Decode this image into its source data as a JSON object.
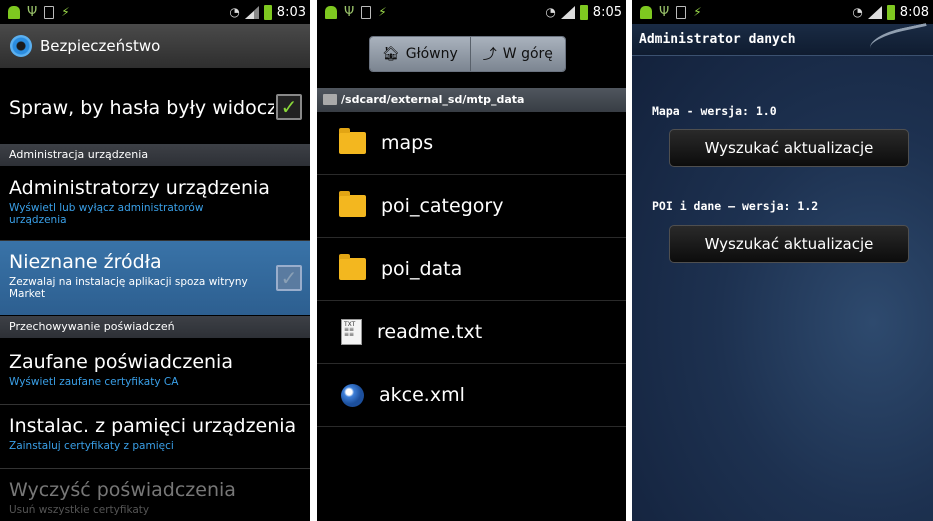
{
  "screens": {
    "security": {
      "time": "8:03",
      "title": "Bezpieczeństwo",
      "show_passwords": "Spraw, by hasła były widoczne",
      "section_admin": "Administracja urządzenia",
      "device_admins": {
        "title": "Administratorzy urządzenia",
        "sub": "Wyświetl lub wyłącz administratorów urządzenia"
      },
      "unknown_sources": {
        "title": "Nieznane źródła",
        "sub": "Zezwalaj na instalację aplikacji spoza witryny Market"
      },
      "section_credentials": "Przechowywanie poświadczeń",
      "trusted": {
        "title": "Zaufane poświadczenia",
        "sub": "Wyświetl zaufane certyfikaty CA"
      },
      "install": {
        "title": "Instalac. z pamięci urządzenia",
        "sub": "Zainstaluj certyfikaty z pamięci"
      },
      "clear": {
        "title": "Wyczyść poświadczenia",
        "sub": "Usuń wszystkie certyfikaty"
      }
    },
    "files": {
      "time": "8:05",
      "home_button": "Główny",
      "up_button": "W górę",
      "path": "/sdcard/external_sd/mtp_data",
      "items": [
        {
          "name": "maps",
          "icon": "folder-icon"
        },
        {
          "name": "poi_category",
          "icon": "folder-icon"
        },
        {
          "name": "poi_data",
          "icon": "folder-icon"
        },
        {
          "name": "readme.txt",
          "icon": "text-file-icon"
        },
        {
          "name": "akce.xml",
          "icon": "globe-icon"
        }
      ]
    },
    "admin": {
      "time": "8:08",
      "header": "Administrator danych",
      "map_version": "Mapa - wersja: 1.0",
      "map_button": "Wyszukać aktualizacje",
      "poi_version": "POI i dane – wersja: 1.2",
      "poi_button": "Wyszukać aktualizacje"
    }
  },
  "colors": {
    "accent_blue": "#3aa0e8",
    "android_green": "#7ec820",
    "folder_yellow": "#f3b71f"
  }
}
